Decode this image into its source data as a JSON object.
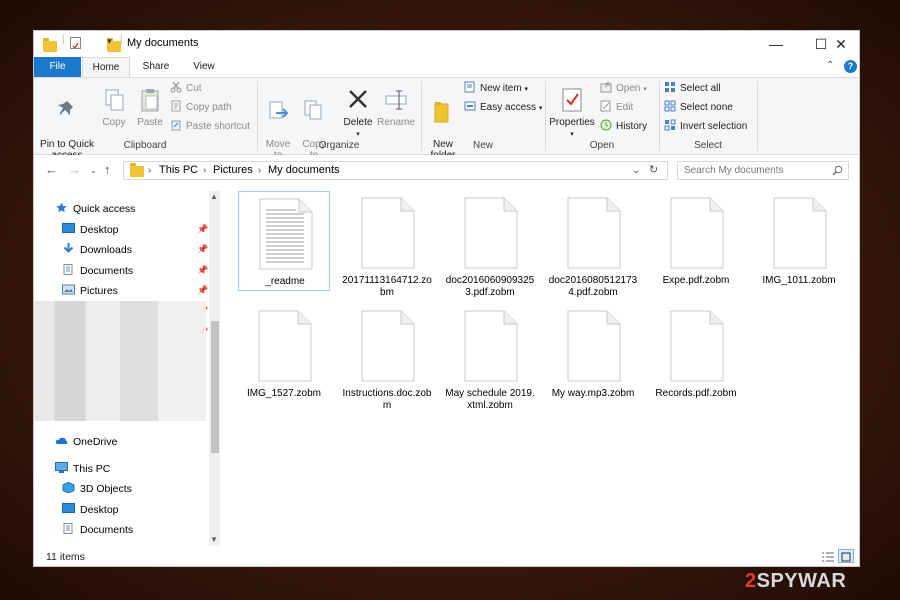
{
  "window": {
    "title": "My documents",
    "controls": {
      "minimize": "—",
      "maximize": "☐",
      "close": "✕"
    }
  },
  "ribbon_tabs": [
    {
      "label": "File"
    },
    {
      "label": "Home"
    },
    {
      "label": "Share"
    },
    {
      "label": "View"
    }
  ],
  "ribbon": {
    "clipboard": {
      "pin": "Pin to Quick\naccess",
      "copy": "Copy",
      "paste": "Paste",
      "cut": "Cut",
      "copy_path": "Copy path",
      "paste_shortcut": "Paste shortcut",
      "label": "Clipboard"
    },
    "organize": {
      "move_to": "Move\nto",
      "copy_to": "Copy\nto",
      "delete": "Delete",
      "rename": "Rename",
      "label": "Organize"
    },
    "new": {
      "new_folder": "New\nfolder",
      "new_item": "New item",
      "easy_access": "Easy access",
      "label": "New"
    },
    "open": {
      "properties": "Properties",
      "open": "Open",
      "edit": "Edit",
      "history": "History",
      "label": "Open"
    },
    "select": {
      "select_all": "Select all",
      "select_none": "Select none",
      "invert": "Invert selection",
      "label": "Select"
    }
  },
  "address": {
    "breadcrumbs": [
      "This PC",
      "Pictures",
      "My documents"
    ],
    "search_placeholder": "Search My documents"
  },
  "nav": {
    "quick_access": "Quick access",
    "quick_items": [
      {
        "label": "Desktop",
        "icon": "desktop-icon"
      },
      {
        "label": "Downloads",
        "icon": "downloads-icon"
      },
      {
        "label": "Documents",
        "icon": "documents-icon"
      },
      {
        "label": "Pictures",
        "icon": "pictures-icon"
      }
    ],
    "onedrive": "OneDrive",
    "this_pc": "This PC",
    "pc_items": [
      {
        "label": "3D Objects",
        "icon": "3d-objects-icon"
      },
      {
        "label": "Desktop",
        "icon": "desktop-icon"
      },
      {
        "label": "Documents",
        "icon": "documents-icon"
      }
    ]
  },
  "files": [
    {
      "name": "_readme",
      "selected": true,
      "icon": "text-file-icon"
    },
    {
      "name": "20171113164712.zobm",
      "icon": "blank-file-icon"
    },
    {
      "name": "doc20160609093253.pdf.zobm",
      "icon": "blank-file-icon"
    },
    {
      "name": "doc20160805121734.pdf.zobm",
      "icon": "blank-file-icon"
    },
    {
      "name": "Expe.pdf.zobm",
      "icon": "blank-file-icon"
    },
    {
      "name": "IMG_1011.zobm",
      "icon": "blank-file-icon"
    },
    {
      "name": "IMG_1527.zobm",
      "icon": "blank-file-icon"
    },
    {
      "name": "Instructions.doc.zobm",
      "icon": "blank-file-icon"
    },
    {
      "name": "May schedule 2019.xtml.zobm",
      "icon": "blank-file-icon"
    },
    {
      "name": "My way.mp3.zobm",
      "icon": "blank-file-icon"
    },
    {
      "name": "Records.pdf.zobm",
      "icon": "blank-file-icon"
    }
  ],
  "status": {
    "item_count": "11 items"
  },
  "watermark": {
    "prefix": "2",
    "text": "SPYWAR"
  }
}
